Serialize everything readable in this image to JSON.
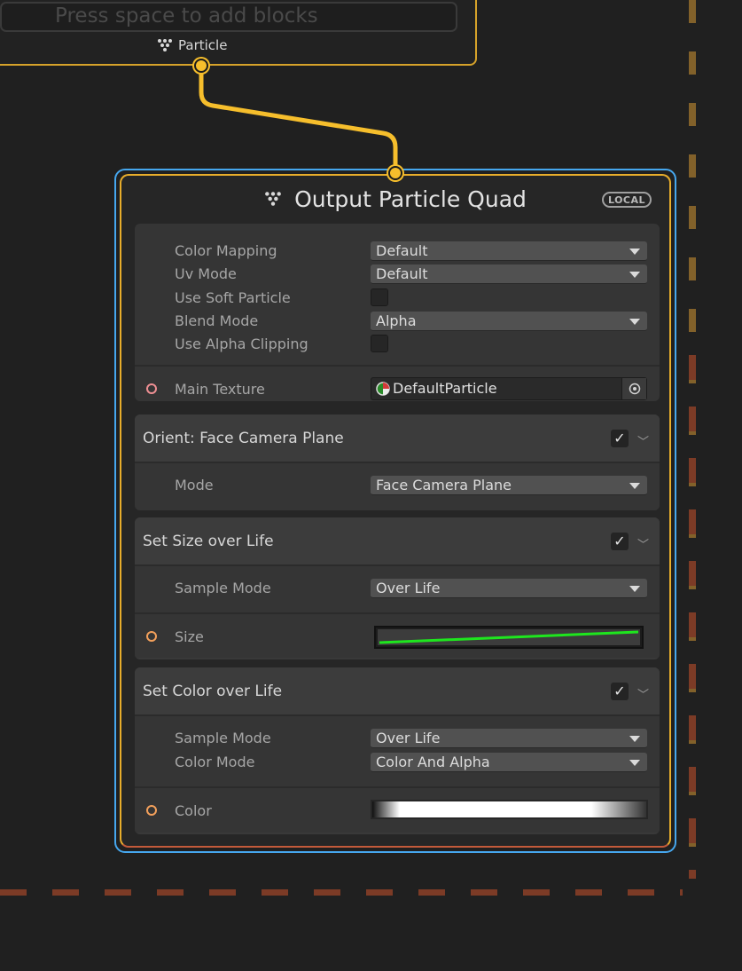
{
  "context_top": {
    "placeholder": "Press space to add blocks",
    "flow_label": "Particle"
  },
  "output_node": {
    "title": "Output Particle Quad",
    "space_badge": "LOCAL",
    "settings": [
      {
        "label": "Color Mapping",
        "kind": "dropdown",
        "value": "Default"
      },
      {
        "label": "Uv Mode",
        "kind": "dropdown",
        "value": "Default"
      },
      {
        "label": "Use Soft Particle",
        "kind": "toggle",
        "value": "off"
      },
      {
        "label": "Blend Mode",
        "kind": "dropdown",
        "value": "Alpha"
      },
      {
        "label": "Use Alpha Clipping",
        "kind": "toggle",
        "value": "off"
      }
    ],
    "main_texture": {
      "label": "Main Texture",
      "value": "DefaultParticle"
    }
  },
  "blocks": {
    "orient": {
      "title": "Orient: Face Camera Plane",
      "enabled": true,
      "mode_label": "Mode",
      "mode_value": "Face Camera Plane"
    },
    "size": {
      "title": "Set Size over Life",
      "enabled": true,
      "sample_mode_label": "Sample Mode",
      "sample_mode_value": "Over Life",
      "size_label": "Size",
      "curve_color": "#1ee61e"
    },
    "color": {
      "title": "Set Color over Life",
      "enabled": true,
      "sample_mode_label": "Sample Mode",
      "sample_mode_value": "Over Life",
      "color_mode_label": "Color Mode",
      "color_mode_value": "Color And Alpha",
      "color_label": "Color"
    }
  },
  "colors": {
    "flow_wire": "#f6be2c",
    "selection": "#46a7ee",
    "node_border": "#e8ad2b"
  }
}
